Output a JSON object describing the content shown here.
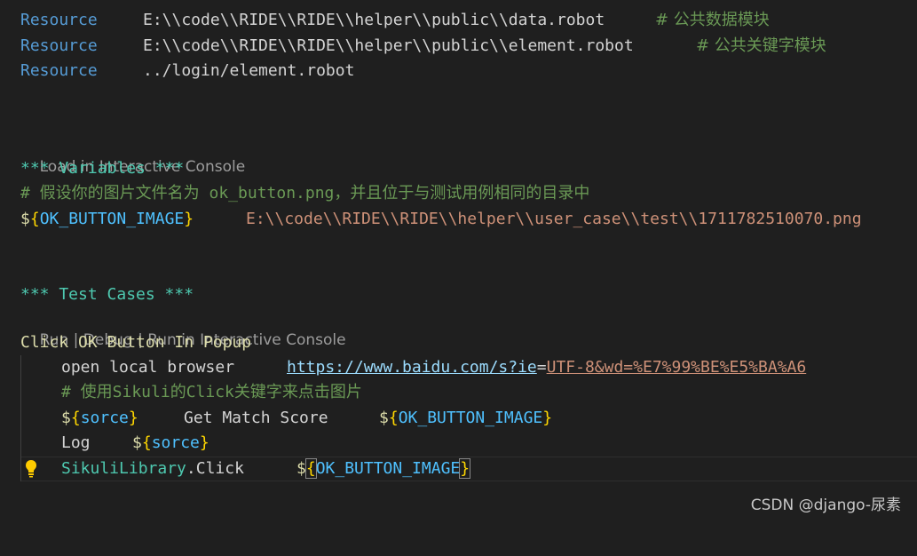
{
  "settings": {
    "lines": [
      {
        "keyword": "Resource",
        "path": "E:\\\\code\\\\RIDE\\\\RIDE\\\\helper\\\\public\\\\data.robot",
        "comment": "# 公共数据模块"
      },
      {
        "keyword": "Resource",
        "path": "E:\\\\code\\\\RIDE\\\\RIDE\\\\helper\\\\public\\\\element.robot",
        "comment": "# 公共关键字模块"
      },
      {
        "keyword": "Resource",
        "path": "../login/element.robot",
        "comment": ""
      }
    ]
  },
  "codelens": {
    "variables": "Load in Interactive Console",
    "run": "Run",
    "sep": " | ",
    "debug": "Debug",
    "run_interactive": "Run in Interactive Console"
  },
  "variables": {
    "header": "*** Variables ***",
    "comment": "# 假设你的图片文件名为 ok_button.png，并且位于与测试用例相同的目录中",
    "var_dollar": "$",
    "var_open": "{",
    "var_name": "OK_BUTTON_IMAGE",
    "var_close": "}",
    "var_value": "E:\\\\code\\\\RIDE\\\\RIDE\\\\helper\\\\user_case\\\\test\\\\1711782510070.png"
  },
  "test_cases": {
    "header": "*** Test Cases ***",
    "name": "Click OK Button In Popup",
    "steps": {
      "open_kw": "open local browser",
      "url_part1": "https://www.baidu.com/s?ie",
      "url_eq": "=",
      "url_part2": "UTF-8&wd=%E7%99%BE%E5%BA%A6",
      "comment": "# 使用Sikuli的Click关键字来点击图片",
      "sorce_var": "sorce",
      "get_match_kw": "Get Match Score",
      "image_var": "OK_BUTTON_IMAGE",
      "log_kw": "Log",
      "lib_name": "SikuliLibrary",
      "dot": ".",
      "click_kw": "Click"
    }
  },
  "watermark": "CSDN @django-尿素",
  "icons": {
    "lightbulb": "lightbulb-icon"
  },
  "colors": {
    "background": "#1f1f1f",
    "keyword": "#569cd6",
    "string": "#ce9178",
    "comment": "#6a9955",
    "section": "#4ec9b0",
    "variable": "#4fc1ff",
    "brace": "#ffd700"
  }
}
